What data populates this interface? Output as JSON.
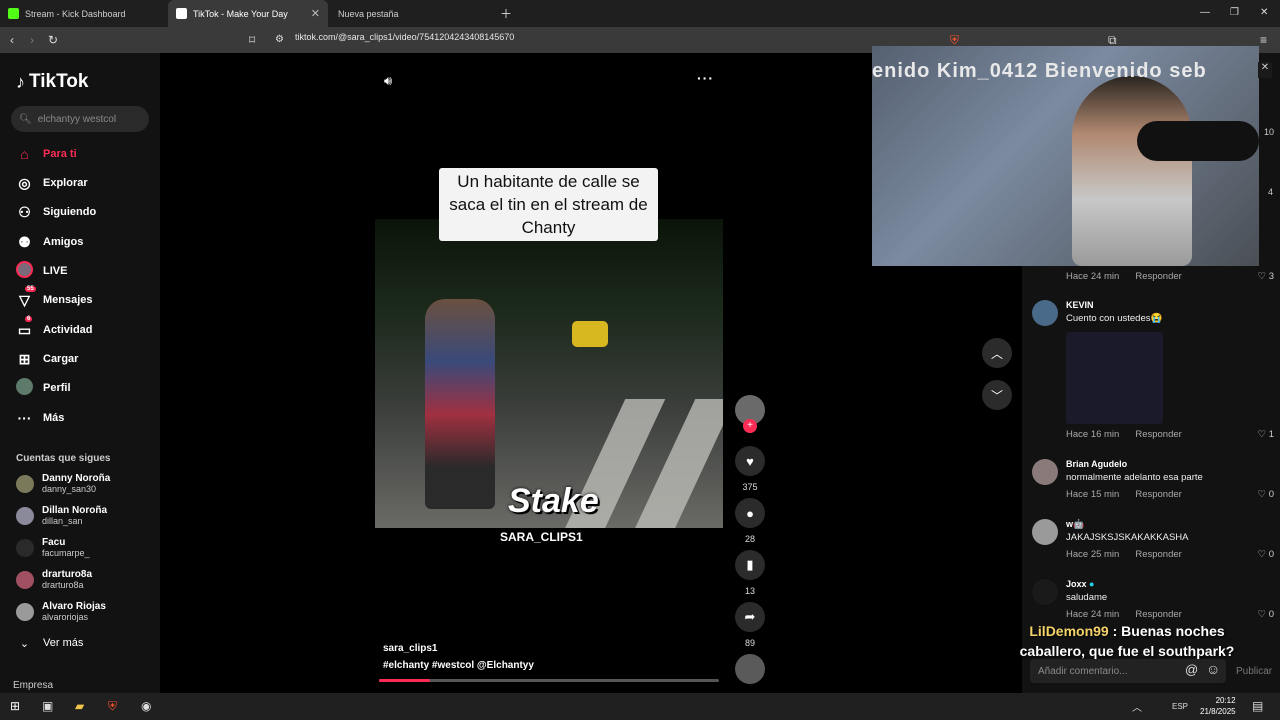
{
  "browser": {
    "tabs": [
      {
        "title": "Stream - Kick Dashboard",
        "favicon_color": "#53fc18"
      },
      {
        "title": "TikTok - Make Your Day",
        "favicon_color": "#ffffff"
      },
      {
        "title": "Nueva pestaña",
        "favicon_color": ""
      }
    ],
    "url": "tiktok.com/@sara_clips1/video/7541204243408145670"
  },
  "sidebar": {
    "logo": "TikTok",
    "search_placeholder": "elchantyy westcol",
    "nav": [
      {
        "label": "Para ti",
        "icon": "home-icon",
        "active": true
      },
      {
        "label": "Explorar",
        "icon": "compass-icon"
      },
      {
        "label": "Siguiendo",
        "icon": "following-icon"
      },
      {
        "label": "Amigos",
        "icon": "friends-icon"
      },
      {
        "label": "LIVE",
        "icon": "live-icon"
      },
      {
        "label": "Mensajes",
        "icon": "messages-icon",
        "badge": "55"
      },
      {
        "label": "Actividad",
        "icon": "activity-icon",
        "badge": "6"
      },
      {
        "label": "Cargar",
        "icon": "upload-icon"
      },
      {
        "label": "Perfil",
        "icon": "profile-icon"
      },
      {
        "label": "Más",
        "icon": "more-icon"
      }
    ],
    "following_title": "Cuentas que sigues",
    "following": [
      {
        "name": "Danny Noroña",
        "handle": "danny_san30"
      },
      {
        "name": "Dillan Noroña",
        "handle": "dillan_san"
      },
      {
        "name": "Facu",
        "handle": "facumarpe_"
      },
      {
        "name": "drarturo8a",
        "handle": "drarturo8a"
      },
      {
        "name": "Alvaro Riojas",
        "handle": "alvaroriojas"
      }
    ],
    "see_more": "Ver más",
    "company": "Empresa"
  },
  "video": {
    "caption": "Un habitante de calle se saca el tin en el stream de Chanty",
    "watermark": "Stake",
    "handle_watermark": "SARA_CLIPS1",
    "author": "sara_clips1",
    "tags": "#elchanty  #westcol  @Elchantyy",
    "progress": 0.15,
    "likes": "375",
    "comments": "28",
    "saves": "13",
    "shares": "89"
  },
  "webcam": {
    "scroll_text": "enido Kim_0412   Bienvenido seb"
  },
  "comments": [
    {
      "name": "",
      "text": "",
      "meta": "Hace 24 min",
      "reply": "Responder",
      "likes": "3"
    },
    {
      "name": "KEVIN",
      "text": "Cuento con ustedes😭",
      "meta": "Hace 16 min",
      "reply": "Responder",
      "likes": "1"
    },
    {
      "name": "Brian Agudelo",
      "text": "normalmente adelanto esa parte",
      "meta": "Hace 15 min",
      "reply": "Responder",
      "likes": "0"
    },
    {
      "name": "w🤖",
      "text": "JAKAJSKSJSKAKAKKASHA",
      "meta": "Hace 25 min",
      "reply": "Responder",
      "likes": "0"
    },
    {
      "name": "Joxx",
      "text": "saludame",
      "meta": "Hace 24 min",
      "reply": "Responder",
      "likes": "0"
    }
  ],
  "hidden_likes": [
    "10",
    "4"
  ],
  "kick_chat": {
    "user": "LilDemon99",
    "message": " : Buenas noches caballero, que fue el southpark?"
  },
  "add_comment_placeholder": "Añadir comentario...",
  "publish": "Publicar",
  "taskbar": {
    "lang": "ESP",
    "time": "20:12",
    "date": "21/8/2025"
  }
}
